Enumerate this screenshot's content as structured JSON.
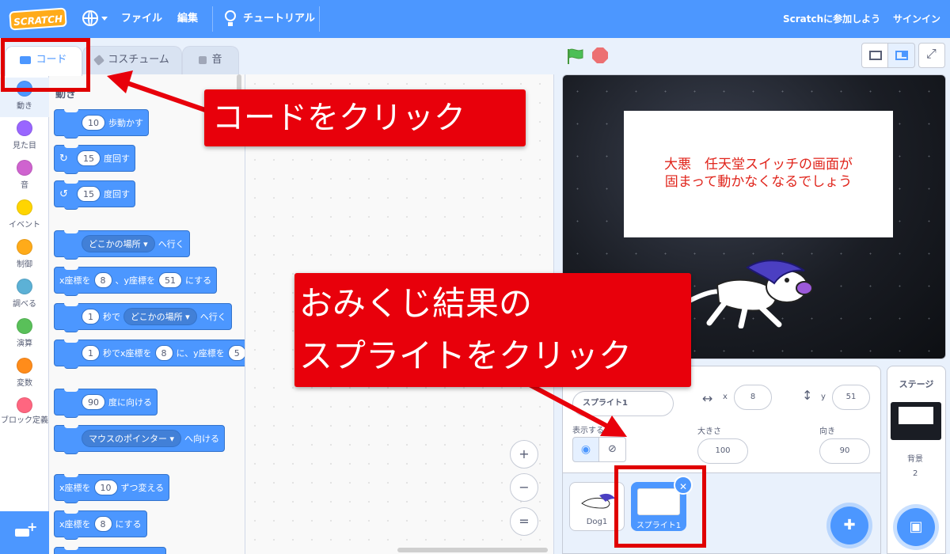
{
  "menubar": {
    "logo": "SCRATCH",
    "file": "ファイル",
    "edit": "編集",
    "tutorial": "チュートリアル",
    "join": "Scratchに参加しよう",
    "signin": "サインイン"
  },
  "tabs": {
    "code": "コード",
    "costumes": "コスチューム",
    "sounds": "音"
  },
  "categories": [
    {
      "label": "動き",
      "color": "#4c97ff"
    },
    {
      "label": "見た目",
      "color": "#9966ff"
    },
    {
      "label": "音",
      "color": "#cf63cf"
    },
    {
      "label": "イベント",
      "color": "#ffd500"
    },
    {
      "label": "制御",
      "color": "#ffab19"
    },
    {
      "label": "調べる",
      "color": "#5cb1d6"
    },
    {
      "label": "演算",
      "color": "#59c059"
    },
    {
      "label": "変数",
      "color": "#ff8c1a"
    },
    {
      "label": "ブロック定義",
      "color": "#ff6680"
    }
  ],
  "palette": {
    "title": "動き",
    "move_steps": {
      "value": "10",
      "text": "歩動かす"
    },
    "turn_right": {
      "value": "15",
      "text": "度回す"
    },
    "turn_left": {
      "value": "15",
      "text": "度回す"
    },
    "goto": {
      "dropdown": "どこかの場所",
      "text": "へ行く"
    },
    "goto_xy": {
      "t1": "x座標を",
      "x": "8",
      "t2": "、y座標を",
      "y": "51",
      "t3": "にする"
    },
    "glide": {
      "secs": "1",
      "t1": "秒で",
      "dropdown": "どこかの場所",
      "t2": "へ行く"
    },
    "glide_xy": {
      "secs": "1",
      "t1": "秒でx座標を",
      "x": "8",
      "t2": "に、y座標を",
      "y": "5"
    },
    "point_dir": {
      "value": "90",
      "text": "度に向ける"
    },
    "point_towards": {
      "dropdown": "マウスのポインター",
      "text": "へ向ける"
    },
    "change_x": {
      "t1": "x座標を",
      "value": "10",
      "t2": "ずつ変える"
    },
    "set_x": {
      "t1": "x座標を",
      "value": "8",
      "t2": "にする"
    }
  },
  "zoom": {
    "in": "+",
    "out": "−",
    "reset": "="
  },
  "stage": {
    "card_line1": "大悪　任天堂スイッチの画面が",
    "card_line2": "固まって動かなくなるでしょう"
  },
  "sprite_info": {
    "name": "スプライト1",
    "x_label": "x",
    "x": "8",
    "y_label": "y",
    "y": "51",
    "show_label": "表示する",
    "size_label": "大きさ",
    "size": "100",
    "direction_label": "向き",
    "direction": "90"
  },
  "sprites": [
    {
      "name": "Dog1"
    },
    {
      "name": "スプライト1"
    }
  ],
  "stage_panel": {
    "title": "ステージ",
    "backdrop_label": "背景",
    "backdrop_count": "2"
  },
  "annotations": {
    "code_callout": "コードをクリック",
    "sprite_callout_line1": "おみくじ結果の",
    "sprite_callout_line2": "スプライトをクリック"
  },
  "colors": {
    "accent": "#4c97ff",
    "annotation_red": "#e8000b"
  }
}
